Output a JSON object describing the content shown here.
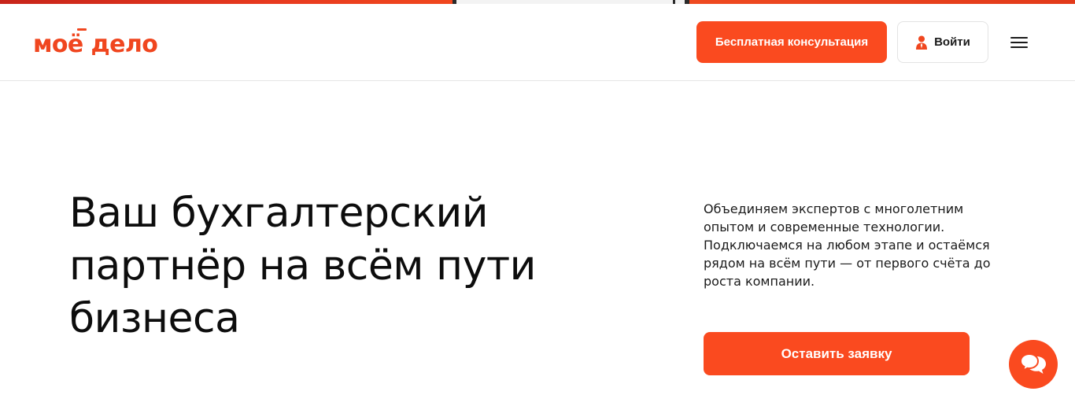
{
  "brand": {
    "logo_text": "моё дело",
    "accent_color": "#fa4a1f"
  },
  "header": {
    "consult_button_label": "Бесплатная консультация",
    "login_label": "Войти",
    "login_icon": "user-icon",
    "menu_icon": "hamburger-menu-icon"
  },
  "hero": {
    "title": "Ваш бухгалтерский партнёр на всём пути бизнеса",
    "description": "Объединяем экспертов с многолетним опытом и современные технологии. Подключаемся на любом этапе и остаёмся рядом на всём пути — от первого счёта до роста компании.",
    "cta_label": "Оставить заявку"
  },
  "chat_widget": {
    "icon": "chat-bubbles-icon"
  }
}
